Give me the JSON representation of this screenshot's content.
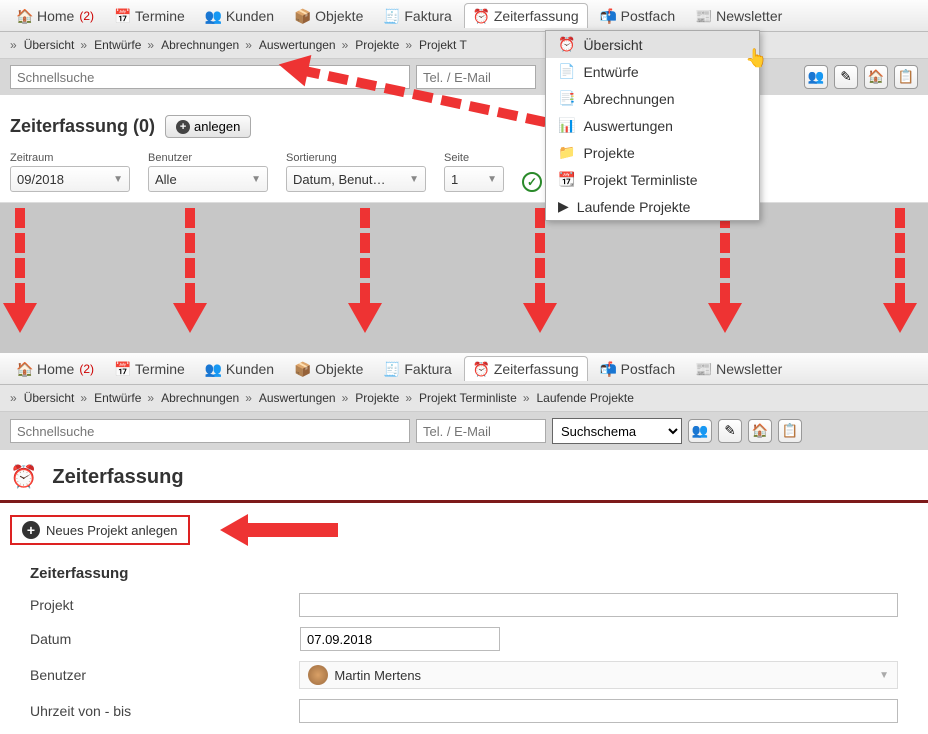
{
  "main_nav": [
    {
      "label": "Home",
      "count": "(2)",
      "icon": "home"
    },
    {
      "label": "Termine",
      "icon": "calendar"
    },
    {
      "label": "Kunden",
      "icon": "people"
    },
    {
      "label": "Objekte",
      "icon": "box"
    },
    {
      "label": "Faktura",
      "icon": "invoice"
    },
    {
      "label": "Zeiterfassung",
      "icon": "clock"
    },
    {
      "label": "Postfach",
      "icon": "mail"
    },
    {
      "label": "Newsletter",
      "icon": "news"
    }
  ],
  "sub_nav": [
    "Übersicht",
    "Entwürfe",
    "Abrechnungen",
    "Auswertungen",
    "Projekte",
    "Projekt Terminliste",
    "Laufende Projekte"
  ],
  "search": {
    "quick_placeholder": "Schnellsuche",
    "tel_placeholder": "Tel. / E-Mail",
    "schema_label": "Suchschema"
  },
  "dropdown": {
    "items": [
      "Übersicht",
      "Entwürfe",
      "Abrechnungen",
      "Auswertungen",
      "Projekte",
      "Projekt Terminliste",
      "Laufende Projekte"
    ]
  },
  "page1": {
    "title": "Zeiterfassung (0)",
    "create_btn": "anlegen",
    "filters": {
      "zeitraum_label": "Zeitraum",
      "zeitraum_value": "09/2018",
      "benutzer_label": "Benutzer",
      "benutzer_value": "Alle",
      "sortierung_label": "Sortierung",
      "sortierung_value": "Datum, Benut…",
      "seite_label": "Seite",
      "seite_value": "1"
    }
  },
  "page2": {
    "title": "Zeiterfassung",
    "new_project_btn": "Neues Projekt anlegen",
    "form_title": "Zeiterfassung",
    "projekt_label": "Projekt",
    "datum_label": "Datum",
    "datum_value": "07.09.2018",
    "benutzer_label": "Benutzer",
    "benutzer_value": "Martin Mertens",
    "uhrzeit_label": "Uhrzeit von - bis"
  }
}
